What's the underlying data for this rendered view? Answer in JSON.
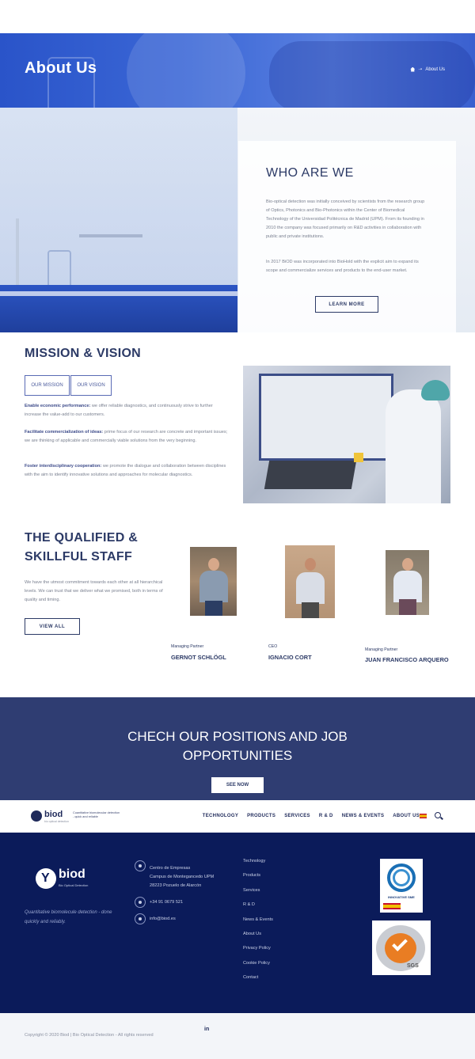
{
  "hero": {
    "title": "About Us",
    "breadcrumb_current": "About Us"
  },
  "who": {
    "title": "WHO ARE WE",
    "p1": "Bio-optical detection was initially conceived by scientists from the research group of Optics, Photonics and Bio-Photonics within the Center of Biomedical Technology of the Universidad Politécnica de Madrid (UPM). From its founding in 2010 the company was focused primarily on R&D activities in collaboration with public and private institutions.",
    "p2": "In 2017 BiOD was incorporated into BioHold with the explicit aim to expand its scope and commercialize services and products to the end-user market.",
    "button": "LEARN MORE"
  },
  "mission": {
    "title": "MISSION & VISION",
    "tabs": [
      "OUR MISSION",
      "OUR VISION"
    ],
    "items": [
      {
        "bold": "Enable economic performance:",
        "text": " we offer reliable diagnostics, and continuously strive to further increase the value-add to our customers."
      },
      {
        "bold": "Facilitate commercialization of ideas:",
        "text": " prime focus of our research are concrete and important issues; we are thinking of applicable and commercially viable solutions from the very beginning."
      },
      {
        "bold": "Foster interdisciplinary cooperation:",
        "text": " we promote the dialogue and collaboration between disciplines with the aim to identify innovative solutions and approaches for molecular diagnostics."
      }
    ]
  },
  "staff": {
    "title_line1": "THE QUALIFIED &",
    "title_line2": "SKILLFUL STAFF",
    "text": "We have the utmost commitment towards each other at all hierarchical levels. We can trust that we deliver what we promised, both in terms of quality and timing.",
    "button": "VIEW ALL",
    "people": [
      {
        "role": "Managing Partner",
        "name": "GERNOT SCHLÖGL"
      },
      {
        "role": "CEO",
        "name": "IGNACIO CORT"
      },
      {
        "role": "Managing Partner",
        "name": "JUAN FRANCISCO ARQUERO"
      }
    ]
  },
  "cta": {
    "line1": "CHECH OUR POSITIONS AND JOB",
    "line2": "OPPORTUNITIES",
    "button": "SEE NOW"
  },
  "nav": {
    "logo": "biod",
    "logo_sub": "bio optical detection",
    "tagline": "Cuantitative biomolecular detection - quick and reliable",
    "links": [
      "TECHNOLOGY",
      "PRODUCTS",
      "SERVICES",
      "R & D",
      "NEWS & EVENTS",
      "ABOUT US"
    ]
  },
  "footer": {
    "logo": "biod",
    "logo_sub": "Bio Optical Detection",
    "tagline": "Quantitative biomolecule detection - done quickly and reliably.",
    "address_line1": "Centro de Empresas",
    "address_line2": "Campus de Montegancedo UPM",
    "address_line3": "28223 Pozuelo de Alarcón",
    "phone": "+34 91 0679 521",
    "email": "info@biod.es",
    "links": [
      "Technology",
      "Products",
      "Services",
      "R & D",
      "News & Events",
      "About Us",
      "Privacy Policy",
      "Cookie Policy",
      "Contact"
    ],
    "badge1_label": "INNOVATIVE SME",
    "badge2_label": "SGS"
  },
  "bottom": {
    "copyright": "Copyright © 2020 Biod | Bio Optical Detection - All rights reserved",
    "social": "in"
  },
  "colors": {
    "navy": "#2c3a66",
    "footer": "#0b1b5a",
    "cta": "#2f3d72",
    "hero": "#3b67d6"
  }
}
